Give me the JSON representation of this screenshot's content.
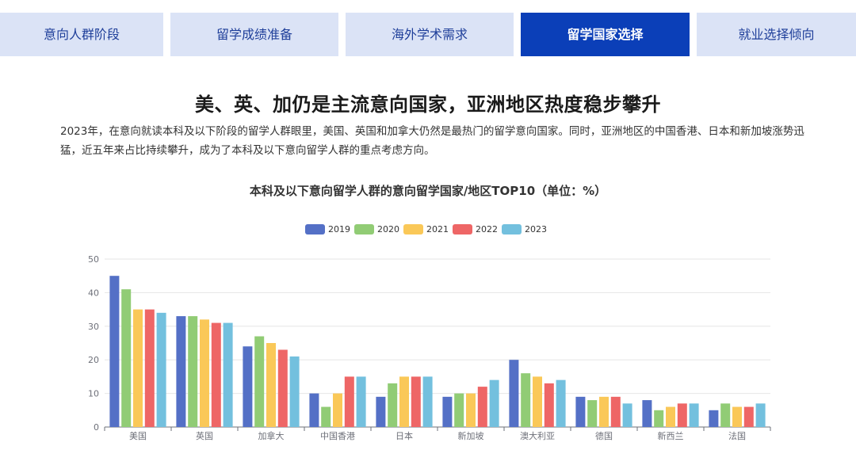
{
  "tabs": [
    {
      "label": "意向人群阶段",
      "active": false
    },
    {
      "label": "留学成绩准备",
      "active": false
    },
    {
      "label": "海外学术需求",
      "active": false
    },
    {
      "label": "留学国家选择",
      "active": true
    },
    {
      "label": "就业选择倾向",
      "active": false
    }
  ],
  "section": {
    "headline": "美、英、加仍是主流意向国家，亚洲地区热度稳步攀升",
    "description": "2023年，在意向就读本科及以下阶段的留学人群眼里，美国、英国和加拿大仍然是最热门的留学意向国家。同时，亚洲地区的中国香港、日本和新加坡涨势迅猛，近五年来占比持续攀升，成为了本科及以下意向留学人群的重点考虑方向。"
  },
  "chart_data": {
    "type": "bar",
    "title": "本科及以下意向留学人群的意向留学国家/地区TOP10（单位：%）",
    "xlabel": "",
    "ylabel": "",
    "ylim": [
      0,
      50
    ],
    "yticks": [
      0,
      10,
      20,
      30,
      40,
      50
    ],
    "grid": true,
    "legend_position": "top-center",
    "categories": [
      "美国",
      "英国",
      "加拿大",
      "中国香港",
      "日本",
      "新加坡",
      "澳大利亚",
      "德国",
      "新西兰",
      "法国"
    ],
    "series": [
      {
        "name": "2019",
        "color": "#5470c6",
        "values": [
          45,
          33,
          24,
          10,
          9,
          9,
          20,
          9,
          8,
          5
        ]
      },
      {
        "name": "2020",
        "color": "#91cc75",
        "values": [
          41,
          33,
          27,
          6,
          13,
          10,
          16,
          8,
          5,
          7
        ]
      },
      {
        "name": "2021",
        "color": "#fac858",
        "values": [
          35,
          32,
          25,
          10,
          15,
          10,
          15,
          9,
          6,
          6
        ]
      },
      {
        "name": "2022",
        "color": "#ee6666",
        "values": [
          35,
          31,
          23,
          15,
          15,
          12,
          13,
          9,
          7,
          6
        ]
      },
      {
        "name": "2023",
        "color": "#73c0de",
        "values": [
          34,
          31,
          21,
          15,
          15,
          14,
          14,
          7,
          7,
          7
        ]
      }
    ]
  }
}
